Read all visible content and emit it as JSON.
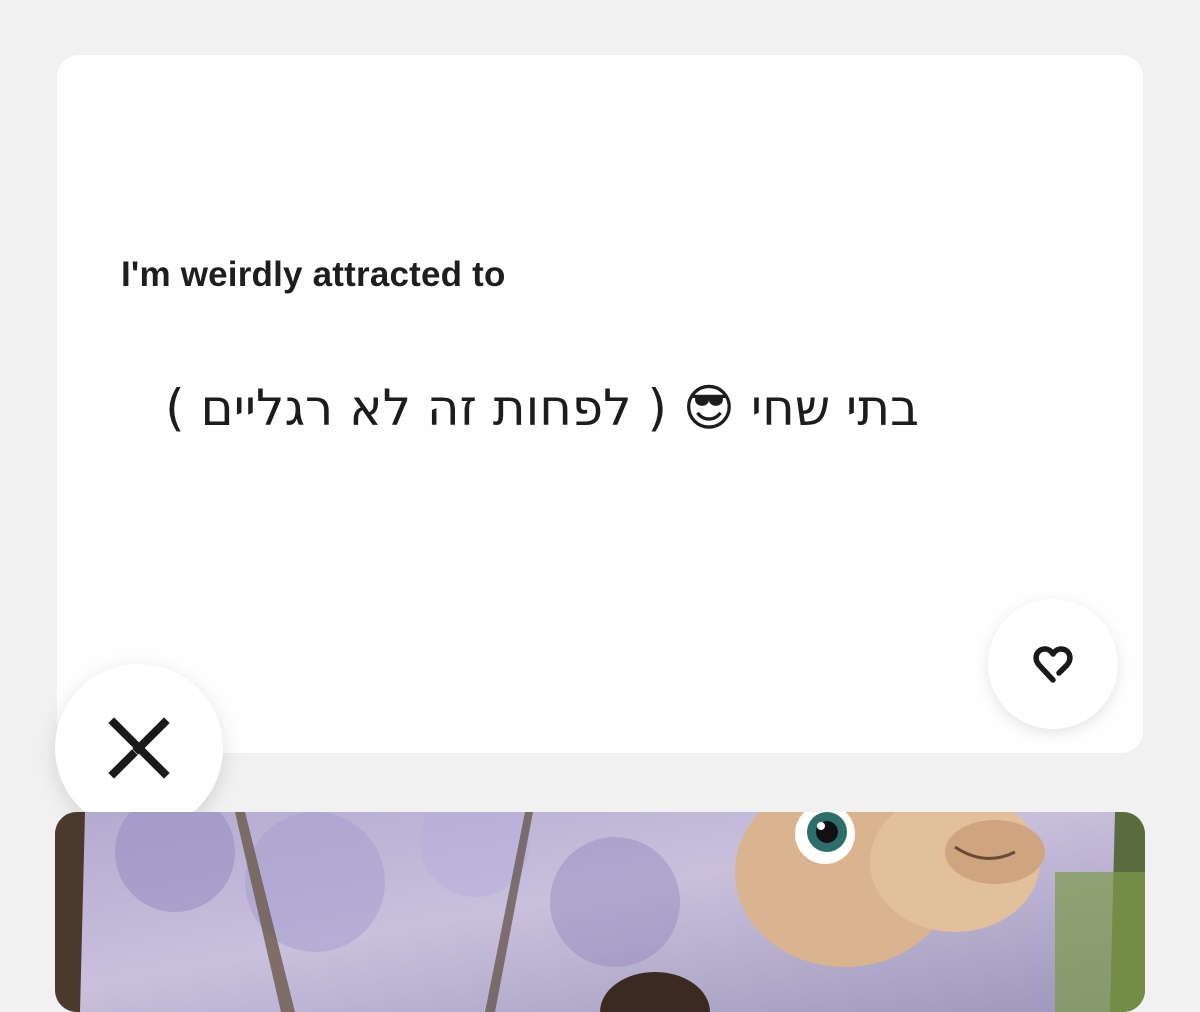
{
  "prompt": {
    "question": "I'm weirdly attracted to",
    "answer": "בתי שחי 😎 ( לפחות זה לא רגליים )"
  },
  "actions": {
    "like_icon": "heart-icon",
    "skip_icon": "close-icon"
  },
  "colors": {
    "background": "#f1f1f1",
    "card": "#fefefe",
    "text": "#1e1e1e",
    "icon": "#1a1a1a"
  }
}
